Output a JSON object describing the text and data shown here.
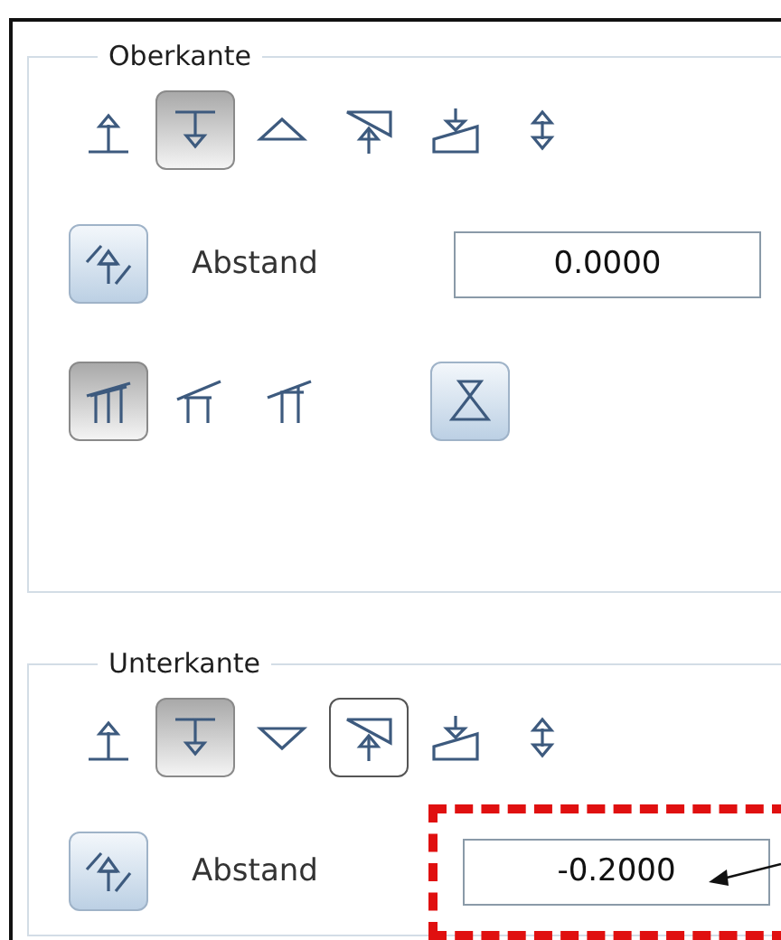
{
  "sections": [
    {
      "title": "Oberkante",
      "edge_tools": [
        {
          "kind": "line-up",
          "pressed": false,
          "outlined": false
        },
        {
          "kind": "line-down",
          "pressed": true,
          "outlined": false
        },
        {
          "kind": "triangle-up",
          "pressed": false,
          "outlined": false
        },
        {
          "kind": "slope-up",
          "pressed": false,
          "outlined": false
        },
        {
          "kind": "ramp-down",
          "pressed": false,
          "outlined": false
        },
        {
          "kind": "double",
          "pressed": false,
          "outlined": false
        }
      ],
      "offset": {
        "toggle_on": true,
        "label": "Abstand",
        "value": "0.0000",
        "highlighted": false
      },
      "roof_tools": [
        {
          "kind": "roof-flat",
          "pressed": true,
          "on": false
        },
        {
          "kind": "roof-left",
          "pressed": false,
          "on": false
        },
        {
          "kind": "roof-right",
          "pressed": false,
          "on": false
        },
        {
          "kind": "trapezoid",
          "pressed": false,
          "on": true
        }
      ]
    },
    {
      "title": "Unterkante",
      "edge_tools": [
        {
          "kind": "line-up",
          "pressed": false,
          "outlined": false
        },
        {
          "kind": "line-down",
          "pressed": true,
          "outlined": false
        },
        {
          "kind": "triangle-down",
          "pressed": false,
          "outlined": false
        },
        {
          "kind": "slope-up",
          "pressed": false,
          "outlined": true
        },
        {
          "kind": "ramp-down",
          "pressed": false,
          "outlined": false
        },
        {
          "kind": "double",
          "pressed": false,
          "outlined": false
        }
      ],
      "offset": {
        "toggle_on": true,
        "label": "Abstand",
        "value": "-0.2000",
        "highlighted": true
      }
    }
  ]
}
